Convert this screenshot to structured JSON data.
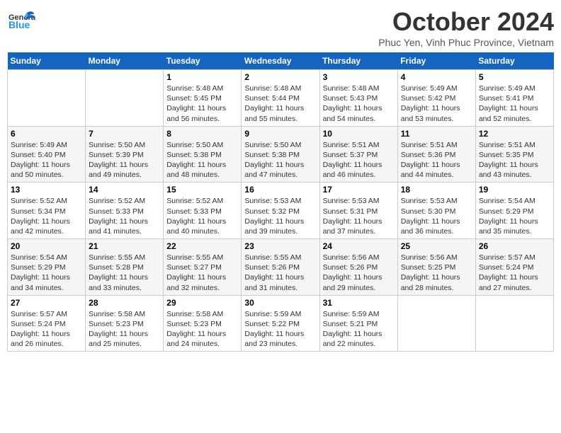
{
  "header": {
    "logo": "GeneralBlue",
    "logo_part1": "General",
    "logo_part2": "Blue",
    "month": "October 2024",
    "location": "Phuc Yen, Vinh Phuc Province, Vietnam"
  },
  "weekdays": [
    "Sunday",
    "Monday",
    "Tuesday",
    "Wednesday",
    "Thursday",
    "Friday",
    "Saturday"
  ],
  "weeks": [
    [
      {
        "day": "",
        "detail": ""
      },
      {
        "day": "",
        "detail": ""
      },
      {
        "day": "1",
        "detail": "Sunrise: 5:48 AM\nSunset: 5:45 PM\nDaylight: 11 hours and 56 minutes."
      },
      {
        "day": "2",
        "detail": "Sunrise: 5:48 AM\nSunset: 5:44 PM\nDaylight: 11 hours and 55 minutes."
      },
      {
        "day": "3",
        "detail": "Sunrise: 5:48 AM\nSunset: 5:43 PM\nDaylight: 11 hours and 54 minutes."
      },
      {
        "day": "4",
        "detail": "Sunrise: 5:49 AM\nSunset: 5:42 PM\nDaylight: 11 hours and 53 minutes."
      },
      {
        "day": "5",
        "detail": "Sunrise: 5:49 AM\nSunset: 5:41 PM\nDaylight: 11 hours and 52 minutes."
      }
    ],
    [
      {
        "day": "6",
        "detail": "Sunrise: 5:49 AM\nSunset: 5:40 PM\nDaylight: 11 hours and 50 minutes."
      },
      {
        "day": "7",
        "detail": "Sunrise: 5:50 AM\nSunset: 5:39 PM\nDaylight: 11 hours and 49 minutes."
      },
      {
        "day": "8",
        "detail": "Sunrise: 5:50 AM\nSunset: 5:38 PM\nDaylight: 11 hours and 48 minutes."
      },
      {
        "day": "9",
        "detail": "Sunrise: 5:50 AM\nSunset: 5:38 PM\nDaylight: 11 hours and 47 minutes."
      },
      {
        "day": "10",
        "detail": "Sunrise: 5:51 AM\nSunset: 5:37 PM\nDaylight: 11 hours and 46 minutes."
      },
      {
        "day": "11",
        "detail": "Sunrise: 5:51 AM\nSunset: 5:36 PM\nDaylight: 11 hours and 44 minutes."
      },
      {
        "day": "12",
        "detail": "Sunrise: 5:51 AM\nSunset: 5:35 PM\nDaylight: 11 hours and 43 minutes."
      }
    ],
    [
      {
        "day": "13",
        "detail": "Sunrise: 5:52 AM\nSunset: 5:34 PM\nDaylight: 11 hours and 42 minutes."
      },
      {
        "day": "14",
        "detail": "Sunrise: 5:52 AM\nSunset: 5:33 PM\nDaylight: 11 hours and 41 minutes."
      },
      {
        "day": "15",
        "detail": "Sunrise: 5:52 AM\nSunset: 5:33 PM\nDaylight: 11 hours and 40 minutes."
      },
      {
        "day": "16",
        "detail": "Sunrise: 5:53 AM\nSunset: 5:32 PM\nDaylight: 11 hours and 39 minutes."
      },
      {
        "day": "17",
        "detail": "Sunrise: 5:53 AM\nSunset: 5:31 PM\nDaylight: 11 hours and 37 minutes."
      },
      {
        "day": "18",
        "detail": "Sunrise: 5:53 AM\nSunset: 5:30 PM\nDaylight: 11 hours and 36 minutes."
      },
      {
        "day": "19",
        "detail": "Sunrise: 5:54 AM\nSunset: 5:29 PM\nDaylight: 11 hours and 35 minutes."
      }
    ],
    [
      {
        "day": "20",
        "detail": "Sunrise: 5:54 AM\nSunset: 5:29 PM\nDaylight: 11 hours and 34 minutes."
      },
      {
        "day": "21",
        "detail": "Sunrise: 5:55 AM\nSunset: 5:28 PM\nDaylight: 11 hours and 33 minutes."
      },
      {
        "day": "22",
        "detail": "Sunrise: 5:55 AM\nSunset: 5:27 PM\nDaylight: 11 hours and 32 minutes."
      },
      {
        "day": "23",
        "detail": "Sunrise: 5:55 AM\nSunset: 5:26 PM\nDaylight: 11 hours and 31 minutes."
      },
      {
        "day": "24",
        "detail": "Sunrise: 5:56 AM\nSunset: 5:26 PM\nDaylight: 11 hours and 29 minutes."
      },
      {
        "day": "25",
        "detail": "Sunrise: 5:56 AM\nSunset: 5:25 PM\nDaylight: 11 hours and 28 minutes."
      },
      {
        "day": "26",
        "detail": "Sunrise: 5:57 AM\nSunset: 5:24 PM\nDaylight: 11 hours and 27 minutes."
      }
    ],
    [
      {
        "day": "27",
        "detail": "Sunrise: 5:57 AM\nSunset: 5:24 PM\nDaylight: 11 hours and 26 minutes."
      },
      {
        "day": "28",
        "detail": "Sunrise: 5:58 AM\nSunset: 5:23 PM\nDaylight: 11 hours and 25 minutes."
      },
      {
        "day": "29",
        "detail": "Sunrise: 5:58 AM\nSunset: 5:23 PM\nDaylight: 11 hours and 24 minutes."
      },
      {
        "day": "30",
        "detail": "Sunrise: 5:59 AM\nSunset: 5:22 PM\nDaylight: 11 hours and 23 minutes."
      },
      {
        "day": "31",
        "detail": "Sunrise: 5:59 AM\nSunset: 5:21 PM\nDaylight: 11 hours and 22 minutes."
      },
      {
        "day": "",
        "detail": ""
      },
      {
        "day": "",
        "detail": ""
      }
    ]
  ]
}
